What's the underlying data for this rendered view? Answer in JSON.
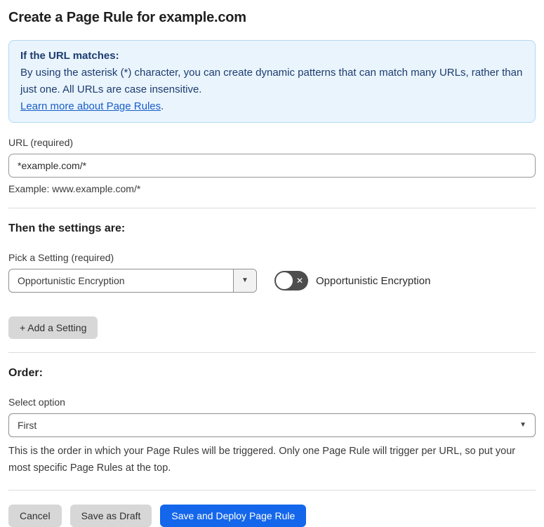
{
  "page": {
    "title": "Create a Page Rule for example.com"
  },
  "colors": {
    "accent_blue": "#1467eb",
    "link_blue": "#1a5dc8",
    "info_background": "#e9f4fd",
    "info_border": "#b5d8f3",
    "info_text": "#1d3c6e",
    "toggle_off_gray": "#4d4d4d",
    "button_gray": "#d7d7d7"
  },
  "icons": {
    "dropdown_caret": "▼",
    "toggle_off_x": "✕"
  },
  "info_box": {
    "heading": "If the URL matches:",
    "body": "By using the asterisk (*) character, you can create dynamic patterns that can match many URLs, rather than just one. All URLs are case insensitive.",
    "link_label": "Learn more about Page Rules",
    "link_suffix": "."
  },
  "url_field": {
    "label": "URL (required)",
    "value": "*example.com/*",
    "example": "Example: www.example.com/*"
  },
  "settings": {
    "heading": "Then the settings are:",
    "picker_label": "Pick a Setting (required)",
    "selected_setting": "Opportunistic Encryption",
    "toggle": {
      "state": "off",
      "label": "Opportunistic Encryption"
    },
    "add_button_label": "+ Add a Setting"
  },
  "order": {
    "heading": "Order:",
    "label": "Select option",
    "selected_option": "First",
    "help": "This is the order in which your Page Rules will be triggered. Only one Page Rule will trigger per URL, so put your most specific Page Rules at the top."
  },
  "footer": {
    "cancel_label": "Cancel",
    "save_draft_label": "Save as Draft",
    "save_deploy_label": "Save and Deploy Page Rule"
  }
}
